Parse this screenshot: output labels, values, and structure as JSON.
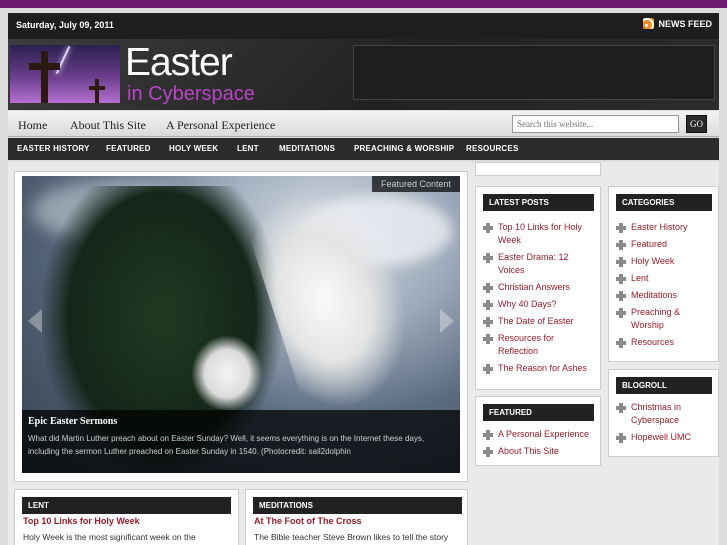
{
  "topbar": {
    "date": "Saturday, July 09, 2011",
    "news_feed": "NEWS FEED"
  },
  "header": {
    "logo_title": "Easter",
    "logo_subtitle": "in Cyberspace"
  },
  "nav_primary": [
    "Home",
    "About This Site",
    "A Personal Experience"
  ],
  "search": {
    "placeholder": "Search this website...",
    "button": "GO"
  },
  "nav_secondary": [
    "EASTER HISTORY",
    "FEATURED",
    "HOLY WEEK",
    "LENT",
    "MEDITATIONS",
    "PREACHING & WORSHIP",
    "RESOURCES"
  ],
  "featured": {
    "label": "Featured Content",
    "title": "Epic Easter Sermons",
    "text": "What did Martin Luther preach about on Easter Sunday? Well, it seems everything is on the Internet these days, including the sermon Luther preached on Easter Sunday in 1540. (Photocredit: sail2dolphin"
  },
  "latest_posts": {
    "heading": "LATEST POSTS",
    "items": [
      "Top 10 Links for Holy Week",
      "Easter Drama: 12 Voices",
      "Christian Answers",
      "Why 40 Days?",
      "The Date of Easter",
      "Resources for Reflection",
      "The Reason for Ashes"
    ]
  },
  "featured_box": {
    "heading": "FEATURED",
    "items": [
      "A Personal Experience",
      "About This Site"
    ]
  },
  "categories": {
    "heading": "CATEGORIES",
    "items": [
      "Easter History",
      "Featured",
      "Holy Week",
      "Lent",
      "Meditations",
      "Preaching & Worship",
      "Resources"
    ]
  },
  "blogroll": {
    "heading": "BLOGROLL",
    "items": [
      "Christmas in Cyberspace",
      "Hopewell UMC"
    ]
  },
  "lent_box": {
    "heading": "LENT",
    "title": "Top 10 Links for Holy Week",
    "text": "Holy Week is the most significant week on the"
  },
  "meditations_box": {
    "heading": "MEDITATIONS",
    "title": "At The Foot of The Cross",
    "text": "The Bible teacher Steve Brown likes to tell the story"
  },
  "colors": {
    "accent": "#9b1d2a",
    "top_line": "#6a1b6e",
    "logo_sub": "#b845c9"
  }
}
